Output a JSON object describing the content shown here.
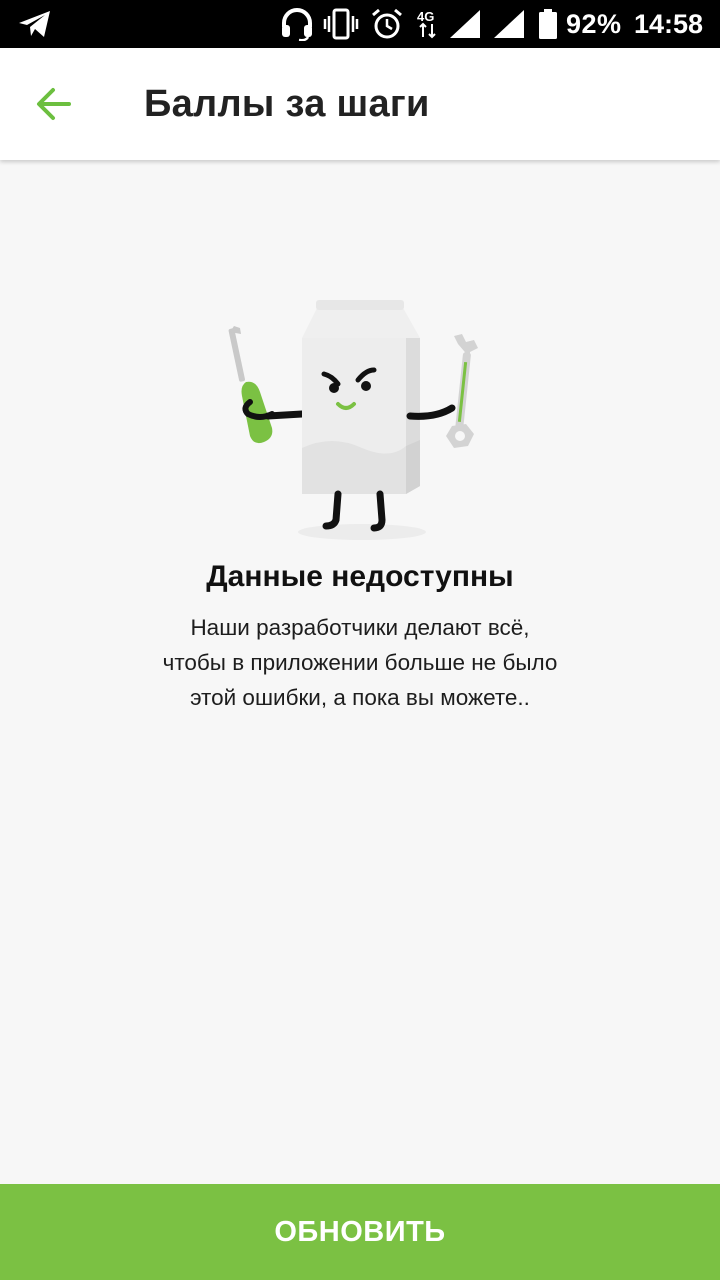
{
  "status_bar": {
    "battery_percent": "92%",
    "time": "14:58",
    "network_label": "4G",
    "icons": [
      "telegram-icon",
      "headset-icon",
      "vibrate-icon",
      "alarm-icon",
      "network-4g-icon",
      "signal-icon",
      "signal-icon",
      "battery-icon"
    ]
  },
  "app_bar": {
    "title": "Баллы за шаги",
    "back_icon": "arrow-left-icon"
  },
  "error": {
    "title": "Данные недоступны",
    "lines": [
      "Наши разработчики делают всё,",
      "чтобы в приложении больше не было",
      "этой ошибки, а пока вы можете.."
    ]
  },
  "actions": {
    "refresh_label": "ОБНОВИТЬ"
  },
  "colors": {
    "accent": "#7bc143",
    "background": "#f7f7f7",
    "status_bar": "#000000"
  }
}
